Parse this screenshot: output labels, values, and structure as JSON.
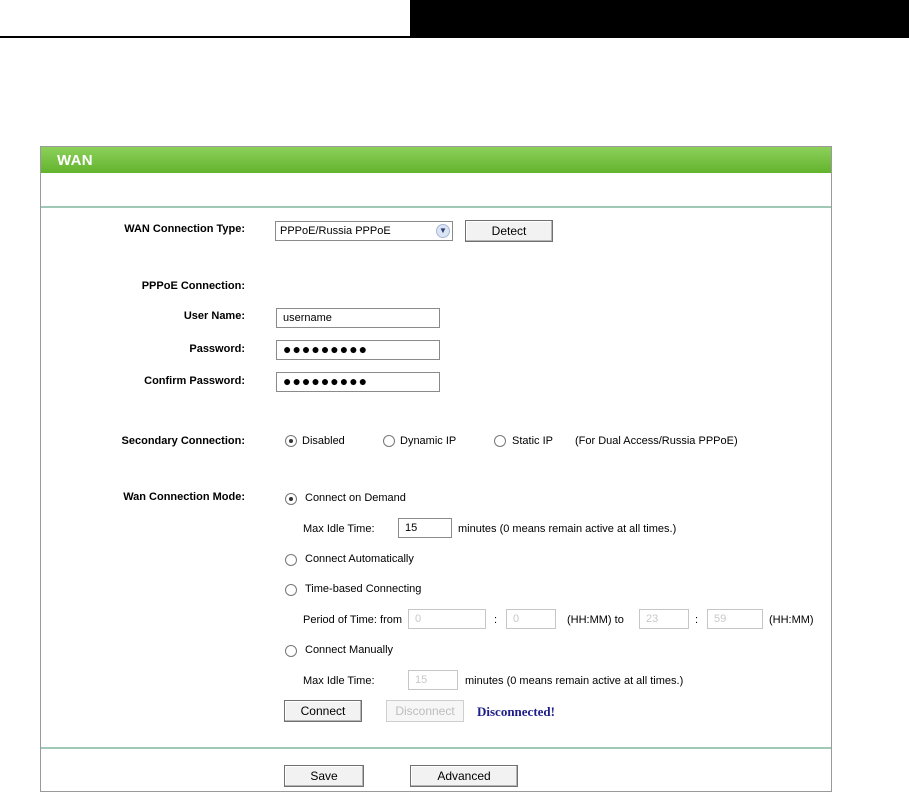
{
  "panel": {
    "title": "WAN"
  },
  "wan_type": {
    "label": "WAN Connection Type:",
    "selected": "PPPoE/Russia PPPoE",
    "detect_label": "Detect"
  },
  "pppoe": {
    "section_label": "PPPoE Connection:",
    "username_label": "User Name:",
    "username_value": "username",
    "password_label": "Password:",
    "password_value": "●●●●●●●●●",
    "confirm_label": "Confirm Password:",
    "confirm_value": "●●●●●●●●●"
  },
  "secondary": {
    "label": "Secondary Connection:",
    "options": [
      "Disabled",
      "Dynamic IP",
      "Static IP"
    ],
    "selected": "Disabled",
    "note": "(For Dual Access/Russia PPPoE)"
  },
  "mode": {
    "label": "Wan Connection Mode:",
    "selected": "Connect on Demand",
    "on_demand": {
      "label": "Connect on Demand",
      "max_idle_label": "Max Idle Time:",
      "max_idle_value": "15",
      "minutes_note": "minutes (0 means remain active at all times.)"
    },
    "auto": {
      "label": "Connect Automatically"
    },
    "time_based": {
      "label": "Time-based Connecting",
      "period_label": "Period of Time: from",
      "from_hh": "0",
      "from_mm": "0",
      "hhmm_to": "(HH:MM) to",
      "to_hh": "23",
      "to_mm": "59",
      "hhmm": "(HH:MM)",
      "sep": ":"
    },
    "manual": {
      "label": "Connect Manually",
      "max_idle_label": "Max Idle Time:",
      "max_idle_value": "15",
      "minutes_note": "minutes (0 means remain active at all times.)"
    }
  },
  "actions": {
    "connect_label": "Connect",
    "disconnect_label": "Disconnect",
    "status": "Disconnected!"
  },
  "footer": {
    "save_label": "Save",
    "advanced_label": "Advanced"
  },
  "colors": {
    "header_green": "#63b32e",
    "divider": "#9fc9b6",
    "status_blue": "#1d1d8a"
  }
}
